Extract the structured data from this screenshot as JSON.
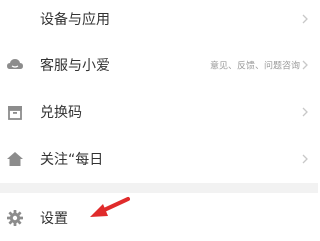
{
  "menu": {
    "items": [
      {
        "label": "设备与应用",
        "icon": "device-icon",
        "sub": ""
      },
      {
        "label": "客服与小爱",
        "icon": "cloud-icon",
        "sub": "意见、反馈、问题咨询"
      },
      {
        "label": "兑换码",
        "icon": "box-icon",
        "sub": ""
      },
      {
        "label": "关注“每日",
        "icon": "home-icon",
        "sub": ""
      },
      {
        "label": "设置",
        "icon": "gear-icon",
        "sub": ""
      }
    ]
  },
  "annotation": {
    "arrow_color": "#e02b2b"
  }
}
